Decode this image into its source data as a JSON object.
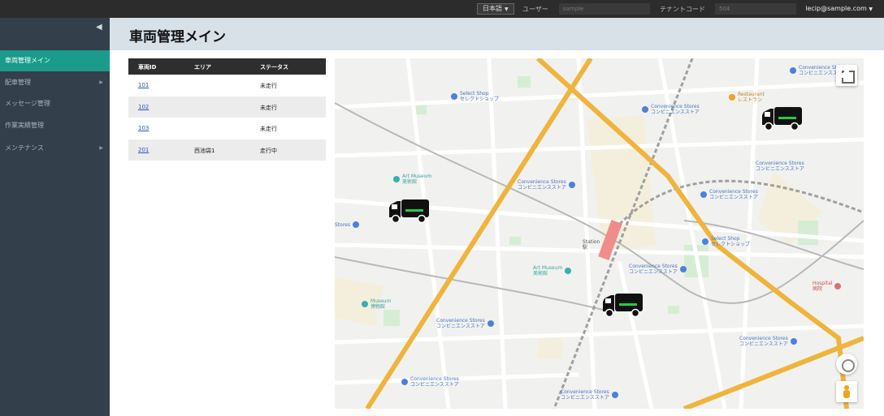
{
  "topbar": {
    "language": "日本語",
    "user_label": "ユーザー",
    "user_placeholder": "sample",
    "tenant_label": "テナントコード",
    "tenant_placeholder": "504",
    "account": "lecip@sample.com"
  },
  "sidebar": {
    "items": [
      {
        "label": "車両管理メイン",
        "active": true
      },
      {
        "label": "配車管理",
        "has_submenu": true
      },
      {
        "label": "メッセージ管理"
      },
      {
        "label": "作業実績管理"
      },
      {
        "label": "メンテナンス",
        "has_submenu": true
      }
    ]
  },
  "header": {
    "title": "車両管理メイン"
  },
  "table": {
    "columns": [
      "車両ID",
      "エリア",
      "ステータス"
    ],
    "rows": [
      {
        "id": "101",
        "area": "",
        "status": "未走行"
      },
      {
        "id": "102",
        "area": "",
        "status": "未走行"
      },
      {
        "id": "103",
        "area": "",
        "status": "未走行"
      },
      {
        "id": "201",
        "area": "西池袋1",
        "status": "走行中"
      }
    ]
  },
  "map": {
    "pois": [
      {
        "line1": "Select Shop",
        "line2": "セレクトショップ"
      },
      {
        "line1": "Convenience Stores",
        "line2": "コンビニエンスストア"
      },
      {
        "line1": "Restaurant",
        "line2": "レストラン"
      },
      {
        "line1": "Convenience Stores",
        "line2": "コンビニエンスストア"
      },
      {
        "line1": "Art Museum",
        "line2": "美術館"
      },
      {
        "line1": "Convenience Stores",
        "line2": "コンビニエンスストア"
      },
      {
        "line1": "Convenience Stores",
        "line2": "コンビニエンスストア"
      },
      {
        "line1": "Select Shop",
        "line2": "セレクトショップ"
      },
      {
        "line1": "Stores",
        "line2": ""
      },
      {
        "line1": "Station",
        "line2": "駅"
      },
      {
        "line1": "Convenience Stores",
        "line2": "コンビニエンスストア"
      },
      {
        "line1": "Art Museum",
        "line2": "美術館"
      },
      {
        "line1": "Hospital",
        "line2": "病院"
      },
      {
        "line1": "Museum",
        "line2": "博物館"
      },
      {
        "line1": "Convenience Stores",
        "line2": "コンビニエンスストア"
      },
      {
        "line1": "Convenience Stores",
        "line2": "コンビニエンスストア"
      },
      {
        "line1": "Convenience Stores",
        "line2": "コンビニエンスストア"
      },
      {
        "line1": "Convenience Stores",
        "line2": "コンビニエンスストア"
      },
      {
        "line1": "Convenience Stores",
        "line2": "コンビニエンスストア"
      }
    ],
    "colors": {
      "main_road": "#f0b43c",
      "rail": "#a0a0a0",
      "station": "#f08c8c",
      "truck_stripe": "#22cc44"
    }
  }
}
